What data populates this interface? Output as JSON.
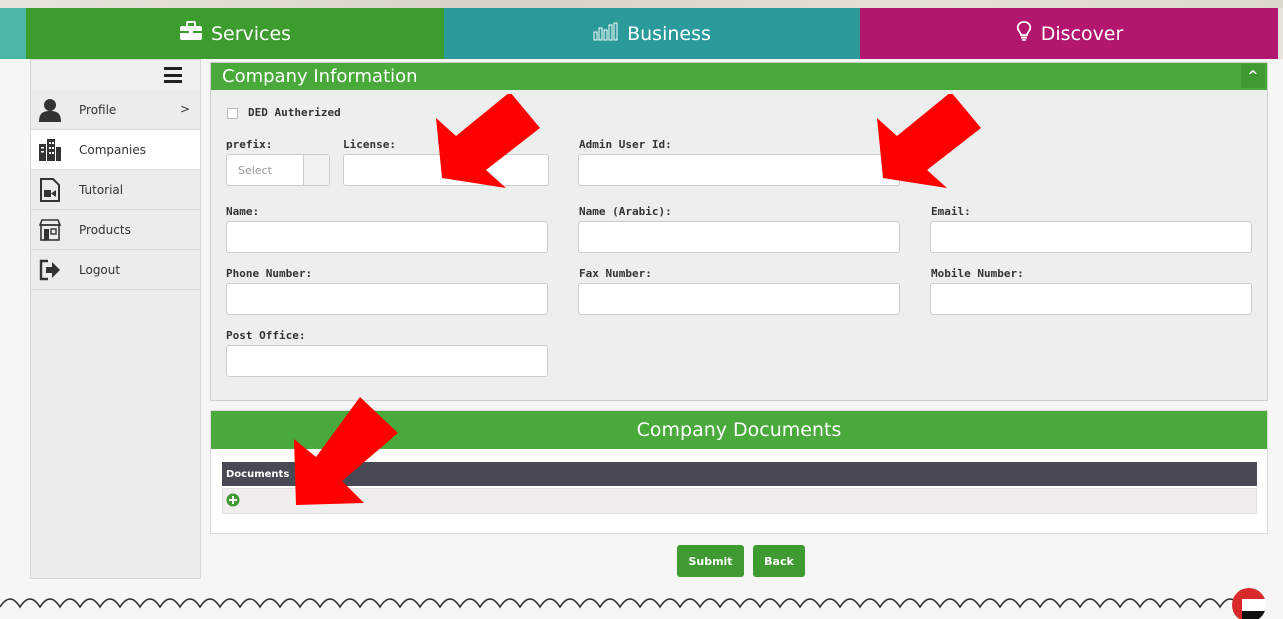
{
  "topbar": {
    "tabs": [
      {
        "label": "Services",
        "color": "#3c9c2d",
        "icon": "briefcase-icon"
      },
      {
        "label": "Business",
        "color": "#2a9a9a",
        "icon": "bar-chart-icon"
      },
      {
        "label": "Discover",
        "color": "#b3166f",
        "icon": "lightbulb-icon"
      }
    ]
  },
  "sidebar": {
    "items": [
      {
        "label": "Profile",
        "icon": "user-icon",
        "has_chevron": true
      },
      {
        "label": "Companies",
        "icon": "building-icon",
        "active": true
      },
      {
        "label": "Tutorial",
        "icon": "video-file-icon"
      },
      {
        "label": "Products",
        "icon": "shop-icon"
      },
      {
        "label": "Logout",
        "icon": "logout-icon"
      }
    ],
    "chevron": ">"
  },
  "company_info": {
    "title": "Company Information",
    "collapse_glyph": "^",
    "ded_label": "DED Autherized",
    "prefix_label": "prefix:",
    "prefix_select": "Select",
    "license_label": "License:",
    "admin_label": "Admin User Id:",
    "name_label": "Name:",
    "name_arabic_label": "Name (Arabic):",
    "email_label": "Email:",
    "phone_label": "Phone Number:",
    "fax_label": "Fax Number:",
    "mobile_label": "Mobile Number:",
    "po_label": "Post Office:"
  },
  "documents": {
    "title": "Company Documents",
    "column_header": "Documents"
  },
  "actions": {
    "submit": "Submit",
    "back": "Back"
  },
  "colors": {
    "accent_green": "#4aa93b",
    "annotation_red": "#ff0000"
  }
}
